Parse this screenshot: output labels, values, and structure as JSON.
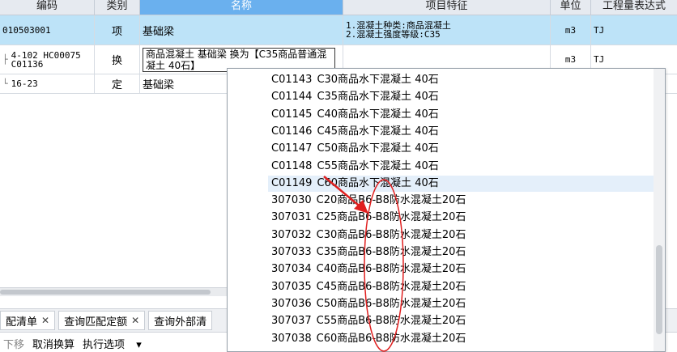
{
  "header": {
    "cols": [
      "编码",
      "类别",
      "名称",
      "项目特征",
      "单位",
      "工程量表达式"
    ]
  },
  "rows": [
    {
      "code": "010503001",
      "type": "项",
      "name": "基础梁",
      "feature_lines": [
        "1.混凝土种类:商品混凝土",
        "2.混凝土强度等级:C35"
      ],
      "unit": "m3",
      "expr": "TJ"
    },
    {
      "code_lines": [
        "4-102 HC00075",
        "C01136"
      ],
      "type": "换",
      "name_edit": "商品混凝土 基础梁  换为【C35商品普通混凝土 40石】",
      "unit": "m3",
      "expr": "TJ"
    },
    {
      "code": "16-23",
      "type": "定",
      "name": "基础梁"
    }
  ],
  "dropdown": {
    "items": [
      {
        "code": "C01143",
        "name": "C30商品水下混凝土 40石"
      },
      {
        "code": "C01144",
        "name": "C35商品水下混凝土 40石"
      },
      {
        "code": "C01145",
        "name": "C40商品水下混凝土 40石"
      },
      {
        "code": "C01146",
        "name": "C45商品水下混凝土 40石"
      },
      {
        "code": "C01147",
        "name": "C50商品水下混凝土 40石"
      },
      {
        "code": "C01148",
        "name": "C55商品水下混凝土 40石"
      },
      {
        "code": "C01149",
        "name": "C60商品水下混凝土 40石"
      },
      {
        "code": "307030",
        "name": "C20商品B6-B8防水混凝土20石"
      },
      {
        "code": "307031",
        "name": "C25商品B6-B8防水混凝土20石"
      },
      {
        "code": "307032",
        "name": "C30商品B6-B8防水混凝土20石"
      },
      {
        "code": "307033",
        "name": "C35商品B6-B8防水混凝土20石"
      },
      {
        "code": "307034",
        "name": "C40商品B6-B8防水混凝土20石"
      },
      {
        "code": "307035",
        "name": "C45商品B6-B8防水混凝土20石"
      },
      {
        "code": "307036",
        "name": "C50商品B6-B8防水混凝土20石"
      },
      {
        "code": "307037",
        "name": "C55商品B6-B8防水混凝土20石"
      },
      {
        "code": "307038",
        "name": "C60商品B6-B8防水混凝土20石"
      }
    ],
    "highlighted_index": 6
  },
  "tabs": [
    {
      "label": "配清单"
    },
    {
      "label": "查询匹配定额"
    },
    {
      "label": "查询外部清"
    }
  ],
  "toolbar": {
    "down": "下移",
    "cancel_convert": "取消换算",
    "exec_options": "执行选项",
    "exec_arrow": "▾"
  },
  "colors": {
    "selected_row": "#bde3f8",
    "header_selected": "#6ab0ee",
    "annotation_red": "#e02020"
  },
  "icons": {
    "tab_close": "close-icon",
    "annotation": "red-arrow-icon"
  }
}
